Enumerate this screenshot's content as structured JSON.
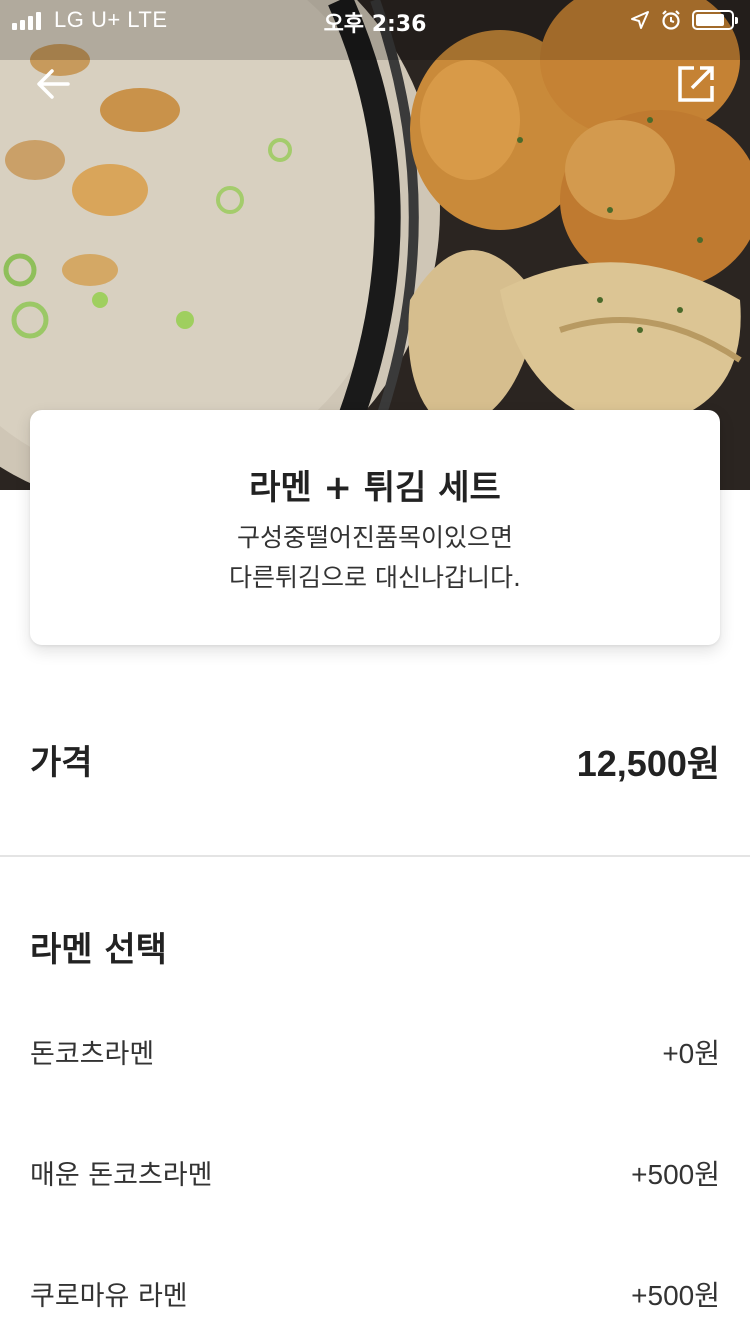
{
  "status_bar": {
    "carrier": "LG U+  LTE",
    "time": "오후 2:36"
  },
  "menu": {
    "title": "라멘 + 튀김 세트",
    "description_line1": "구성중떨어진품목이있으면",
    "description_line2": "다른튀김으로 대신나갑니다."
  },
  "price": {
    "label": "가격",
    "value": "12,500원"
  },
  "option_group": {
    "title": "라멘 선택",
    "options": [
      {
        "name": "돈코츠라멘",
        "price": "+0원"
      },
      {
        "name": "매운 돈코츠라멘",
        "price": "+500원"
      },
      {
        "name": "쿠로마유 라멘",
        "price": "+500원"
      }
    ]
  },
  "icons": {
    "back": "arrow-left-icon",
    "share": "share-external-icon",
    "location": "location-arrow-icon",
    "alarm": "alarm-clock-icon",
    "battery": "battery-icon",
    "signal": "signal-bars-icon"
  }
}
